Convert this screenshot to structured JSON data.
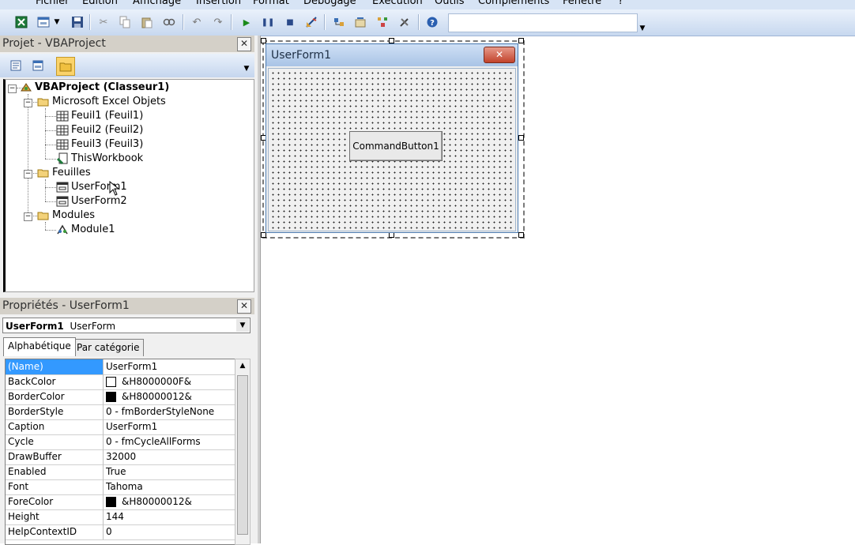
{
  "menubar": {
    "items": [
      "Fichier",
      "Edition",
      "Affichage",
      "Insertion",
      "Format",
      "Débogage",
      "Exécution",
      "Outils",
      "Compléments",
      "Fenêtre",
      "?"
    ]
  },
  "toolbar": {
    "icons": [
      "excel-icon",
      "userform-insert-icon",
      "dropdown-icon",
      "save-icon",
      "cut-icon",
      "copy-icon",
      "paste-icon",
      "find-icon",
      "undo-icon",
      "redo-icon",
      "run-icon",
      "pause-icon",
      "stop-icon",
      "design-mode-icon",
      "project-explorer-icon",
      "properties-icon",
      "object-browser-icon",
      "toolbox-icon",
      "help-icon"
    ],
    "combo_value": ""
  },
  "project": {
    "title": "Projet - VBAProject",
    "tree": {
      "root": "VBAProject (Classeur1)",
      "folders": [
        {
          "label": "Microsoft Excel Objets",
          "items": [
            "Feuil1 (Feuil1)",
            "Feuil2 (Feuil2)",
            "Feuil3 (Feuil3)",
            "ThisWorkbook"
          ]
        },
        {
          "label": "Feuilles",
          "items": [
            "UserForm1",
            "UserForm2"
          ]
        },
        {
          "label": "Modules",
          "items": [
            "Module1"
          ]
        }
      ]
    }
  },
  "properties": {
    "title": "Propriétés - UserForm1",
    "object_name": "UserForm1",
    "object_type": "UserForm",
    "tabs": [
      "Alphabétique",
      "Par catégorie"
    ],
    "rows": [
      {
        "name": "(Name)",
        "value": "UserForm1"
      },
      {
        "name": "BackColor",
        "value": "&H8000000F&",
        "swatch": "#ffffff"
      },
      {
        "name": "BorderColor",
        "value": "&H80000012&",
        "swatch": "#000000"
      },
      {
        "name": "BorderStyle",
        "value": "0 - fmBorderStyleNone"
      },
      {
        "name": "Caption",
        "value": "UserForm1"
      },
      {
        "name": "Cycle",
        "value": "0 - fmCycleAllForms"
      },
      {
        "name": "DrawBuffer",
        "value": "32000"
      },
      {
        "name": "Enabled",
        "value": "True"
      },
      {
        "name": "Font",
        "value": "Tahoma"
      },
      {
        "name": "ForeColor",
        "value": "&H80000012&",
        "swatch": "#000000"
      },
      {
        "name": "Height",
        "value": "144"
      },
      {
        "name": "HelpContextID",
        "value": "0"
      }
    ]
  },
  "designer": {
    "form_title": "UserForm1",
    "close_glyph": "✕",
    "button_label": "CommandButton1"
  }
}
